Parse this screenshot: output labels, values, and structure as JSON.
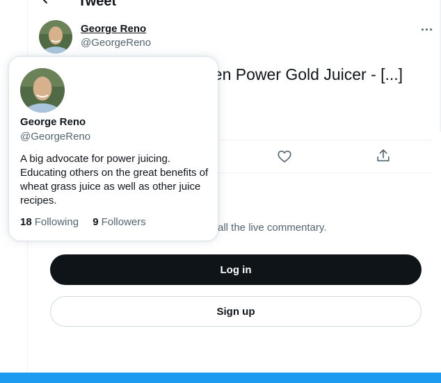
{
  "header": {
    "title": "Tweet",
    "back_icon": "back-arrow-icon"
  },
  "tweet": {
    "author_name": "George Reno",
    "author_handle": "@GeorgeReno",
    "text_visible": "een Power Gold Juicer - [...]",
    "more_icon": "more-dots-icon",
    "like_icon": "heart-icon",
    "share_icon": "share-icon"
  },
  "prompt": {
    "text_visible": "all the live commentary."
  },
  "auth": {
    "login_label": "Log in",
    "signup_label": "Sign up"
  },
  "hover_card": {
    "name": "George Reno",
    "handle": "@GeorgeReno",
    "bio": "A big advocate for power juicing. Educating others on the great benefits of wheat grass juice as well as other juice recipes.",
    "following_count": "18",
    "following_label": "Following",
    "followers_count": "9",
    "followers_label": "Followers"
  },
  "colors": {
    "text_primary": "#0f1419",
    "text_secondary": "#536471",
    "brand_blue": "#1d9bf0",
    "border": "#eff3f4"
  }
}
